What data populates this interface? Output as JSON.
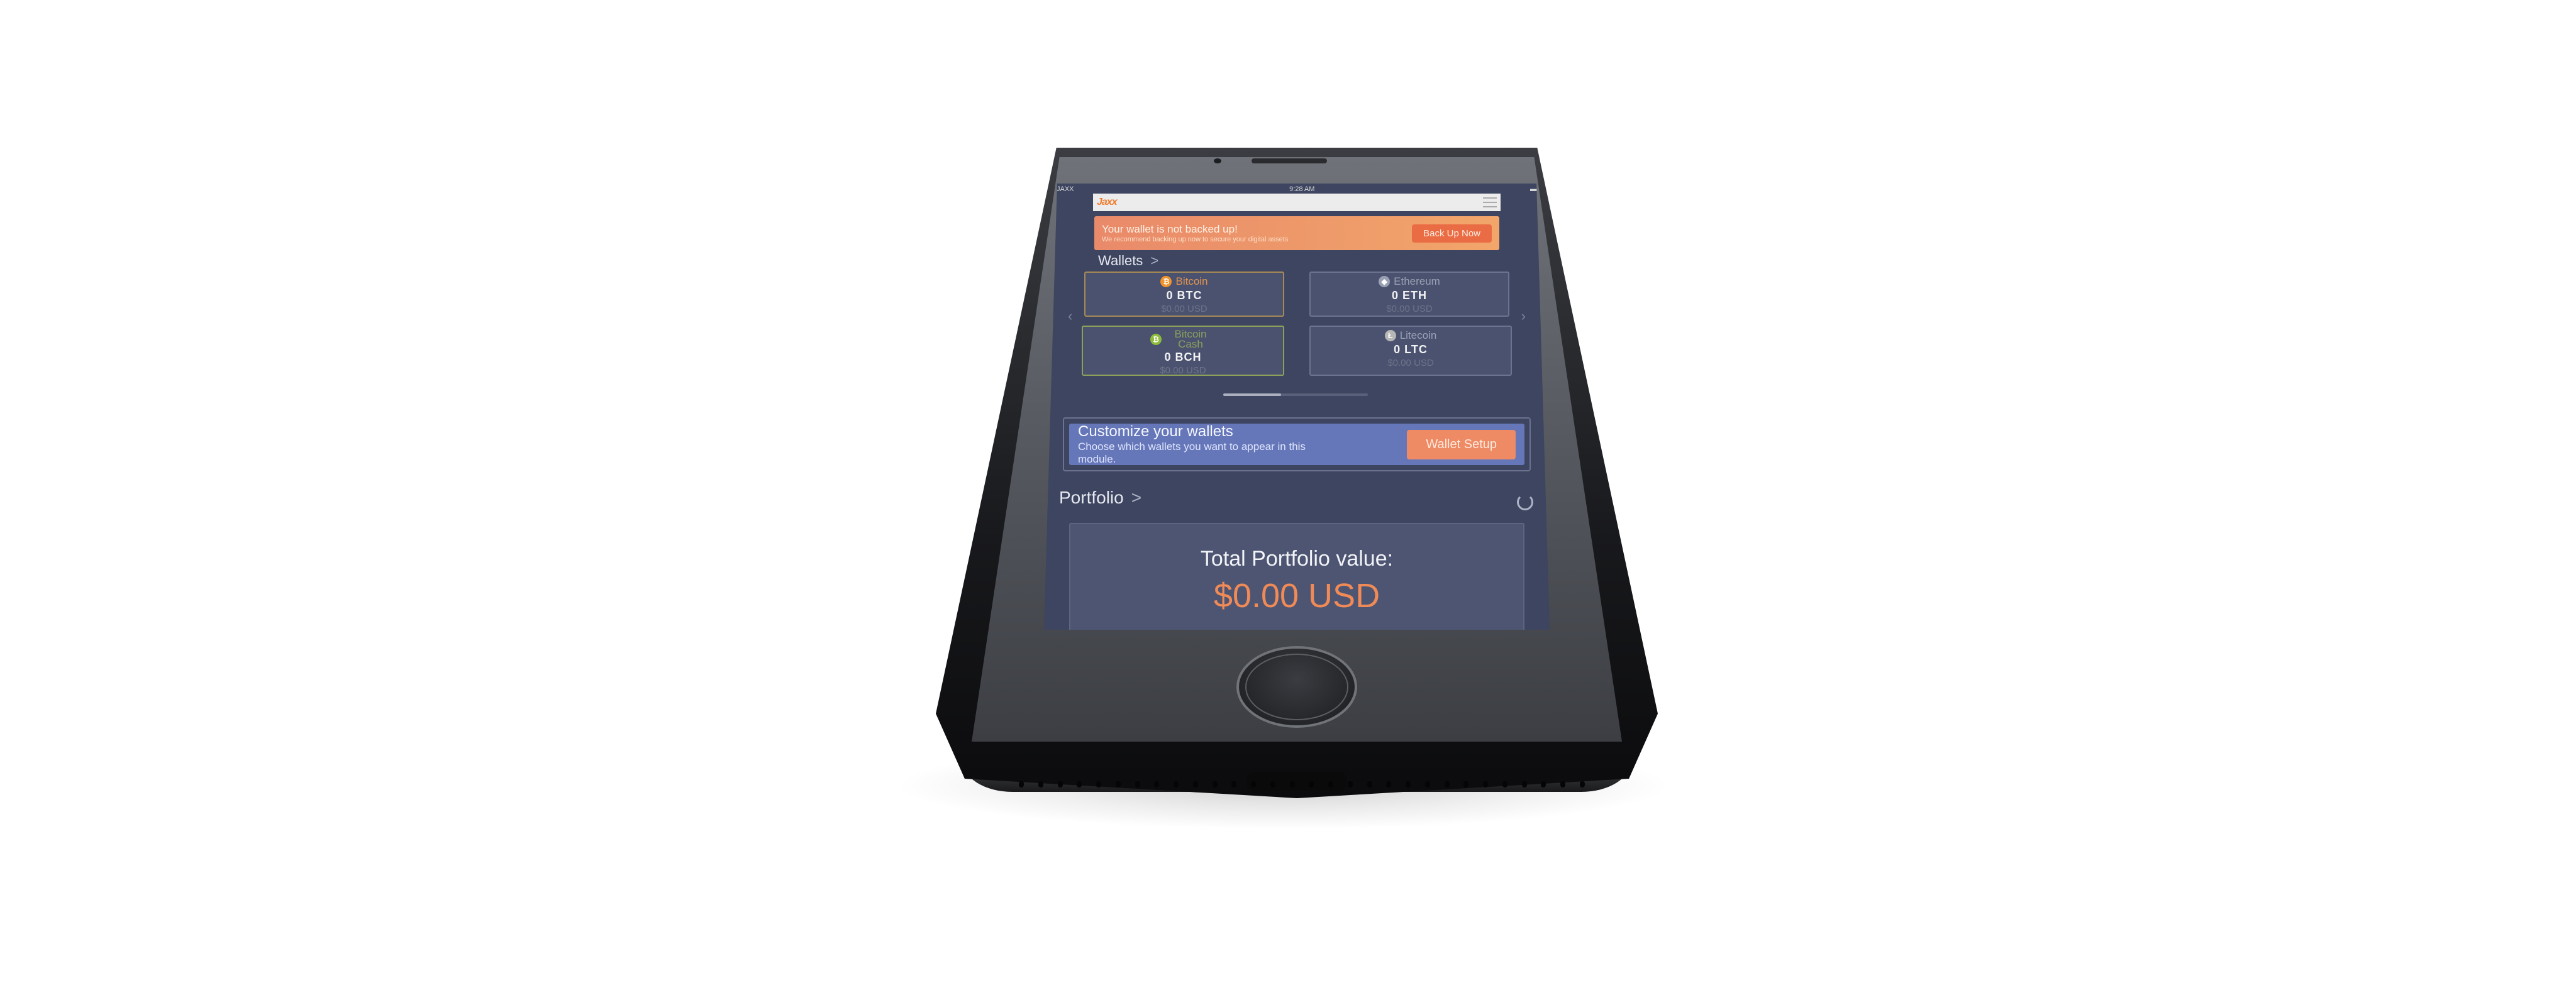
{
  "status_bar": {
    "carrier": "JAXX",
    "time": "9:28 AM"
  },
  "app": {
    "logo_text": "Jaxx"
  },
  "backup_banner": {
    "title": "Your wallet is not backed up!",
    "subtitle": "We recommend backing up now to secure your digital assets",
    "button_label": "Back Up Now"
  },
  "wallets": {
    "title": "Wallets",
    "chevron": ">",
    "items": [
      {
        "name": "Bitcoin",
        "amount": "0 BTC",
        "fiat": "$0.00 USD",
        "icon": "bitcoin-icon",
        "color": "#f0932c"
      },
      {
        "name": "Ethereum",
        "amount": "0 ETH",
        "fiat": "$0.00 USD",
        "icon": "ethereum-icon",
        "color": "#9aa0b3"
      },
      {
        "name": "Bitcoin Cash",
        "amount": "0 BCH",
        "fiat": "$0.00 USD",
        "icon": "bitcoin-cash-icon",
        "color": "#8dbb3a"
      },
      {
        "name": "Litecoin",
        "amount": "0 LTC",
        "fiat": "$0.00 USD",
        "icon": "litecoin-icon",
        "color": "#b6b6b6"
      }
    ],
    "scroll_progress": 0.4
  },
  "customize": {
    "title": "Customize your wallets",
    "subtitle": "Choose which wallets you want to appear in this module.",
    "button_label": "Wallet Setup"
  },
  "portfolio": {
    "title": "Portfolio",
    "chevron": ">",
    "total_label": "Total Portfolio value:",
    "total_value": "$0.00 USD"
  },
  "colors": {
    "accent": "#f08a56",
    "screen_bg": "#3d4560",
    "customize_bg": "#6577b8"
  }
}
